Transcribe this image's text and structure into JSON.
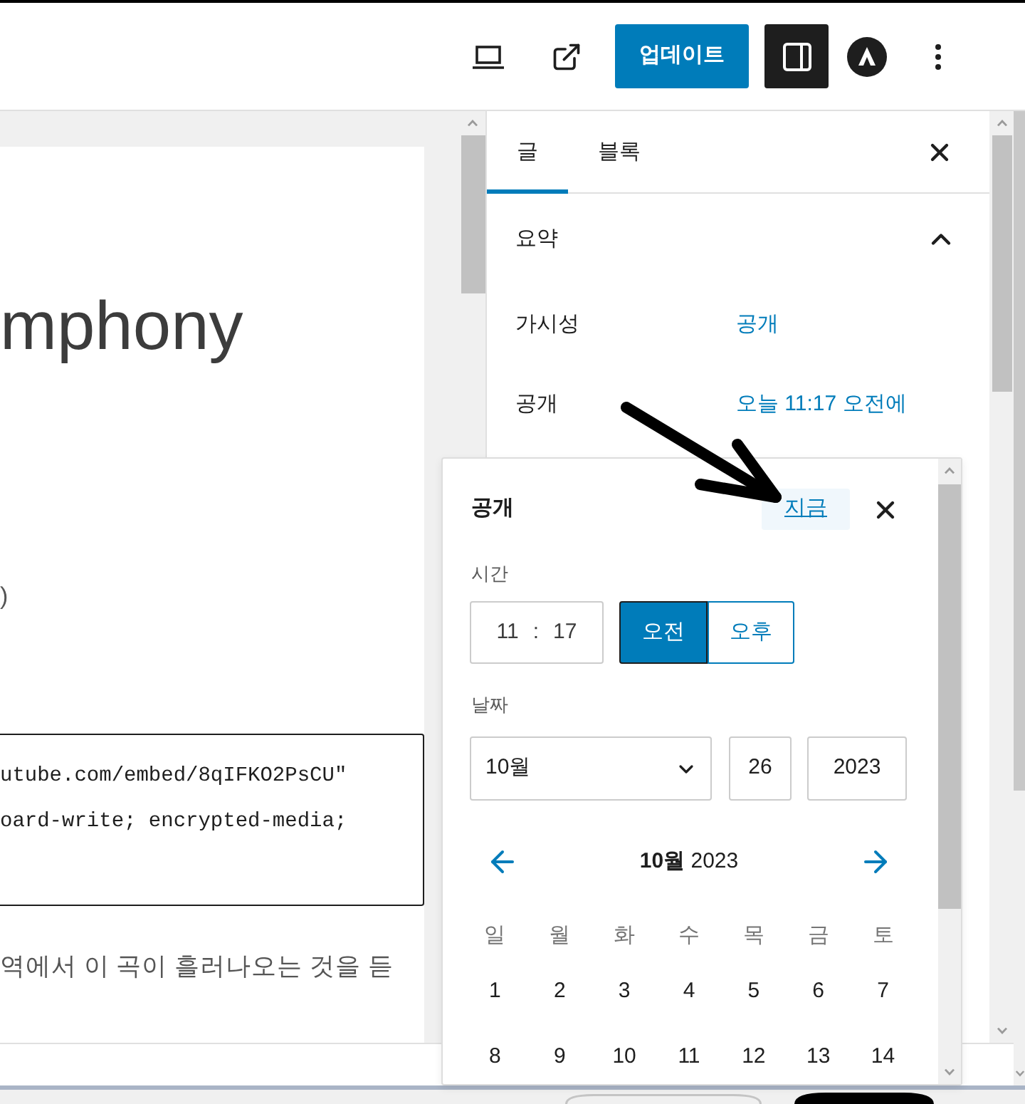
{
  "toolbar": {
    "update_button": "업데이트",
    "settings_toggle": {
      "pressed": true
    }
  },
  "editor": {
    "title": "mphony",
    "fragment": ")",
    "code_lines": [
      "utube.com/embed/8qIFKO2PsCU\"",
      "oard-write; encrypted-media;"
    ],
    "paragraph": "역에서 이 곡이 흘러나오는 것을 듣"
  },
  "sidebar": {
    "tabs": [
      {
        "label": "글",
        "selected": true
      },
      {
        "label": "블록",
        "selected": false
      }
    ],
    "panel": {
      "title": "요약",
      "expanded": true,
      "rows": [
        {
          "label": "가시성",
          "value": "공개"
        },
        {
          "label": "공개",
          "value": "오늘 11:17 오전에"
        }
      ]
    }
  },
  "popover": {
    "title": "공개",
    "now_button": "지금",
    "time_label": "시간",
    "hours": "11",
    "separator": ":",
    "minutes": "17",
    "meridiem": [
      {
        "label": "오전",
        "selected": true
      },
      {
        "label": "오후",
        "selected": false
      }
    ],
    "date_label": "날짜",
    "month": "10월",
    "day": "26",
    "year": "2023",
    "calendar": {
      "title": "**10월** 2023",
      "weekdays": [
        "일",
        "월",
        "화",
        "수",
        "목",
        "금",
        "토"
      ],
      "weeks": [
        [
          "1",
          "2",
          "3",
          "4",
          "5",
          "6",
          "7"
        ],
        [
          "8",
          "9",
          "10",
          "11",
          "12",
          "13",
          "14"
        ]
      ]
    }
  }
}
